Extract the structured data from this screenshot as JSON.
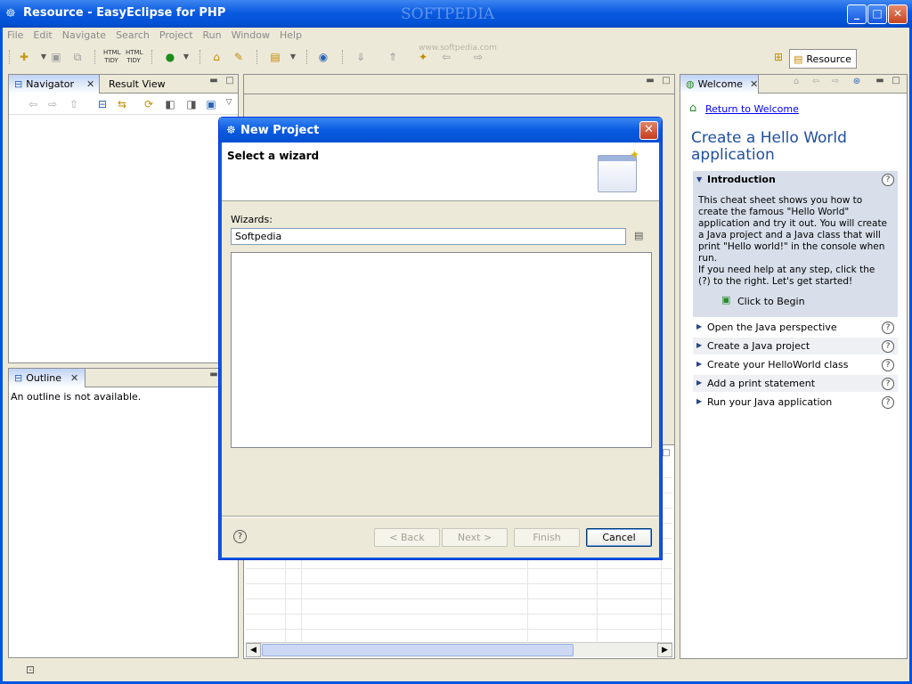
{
  "window": {
    "title": "Resource - EasyEclipse for PHP",
    "watermark": "SOFTPEDIA",
    "watermark_small": "www.softpedia.com",
    "controls": {
      "minimize": "_",
      "maximize": "□",
      "close": "✕"
    }
  },
  "menu": [
    "File",
    "Edit",
    "Navigate",
    "Search",
    "Project",
    "Run",
    "Window",
    "Help"
  ],
  "perspective": {
    "label": "Resource"
  },
  "navigator": {
    "tabs": [
      "Navigator",
      "Result View"
    ]
  },
  "outline": {
    "tab": "Outline",
    "message": "An outline is not available."
  },
  "dialog": {
    "title": "New Project",
    "heading": "Select a wizard",
    "wizards_label": "Wizards:",
    "filter_value": "Softpedia",
    "buttons": {
      "back": "< Back",
      "next": "Next >",
      "finish": "Finish",
      "cancel": "Cancel"
    },
    "help": "?"
  },
  "welcome": {
    "tab": "Welcome",
    "return_link": "Return to Welcome",
    "title": "Create a Hello World application",
    "intro_header": "Introduction",
    "intro_p1": "This cheat sheet shows you how to create the famous \"Hello World\" application and try it out. You will create a Java project and a Java class that will print \"Hello world!\" in the console when run.",
    "intro_p2": "If you need help at any step, click the (?) to the right. Let's get started!",
    "click_to_begin": "Click to Begin",
    "steps": [
      "Open the Java perspective",
      "Create a Java project",
      "Create your HelloWorld class",
      "Add a print statement",
      "Run your Java application"
    ],
    "help_glyph": "?"
  },
  "colors": {
    "titlebar": "#0a5ae0",
    "link": "#0000ff",
    "cheat_title": "#1f4e9e",
    "intro_bg": "#d8dfeb"
  }
}
